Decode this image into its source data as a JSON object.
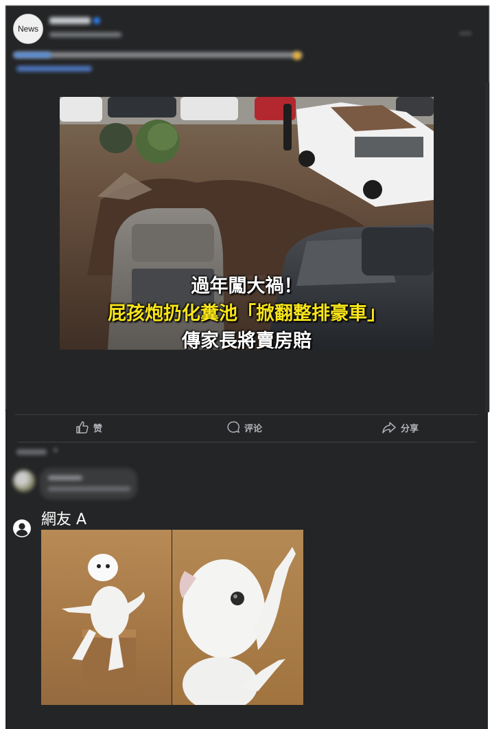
{
  "post": {
    "avatar_text": "News",
    "image_caption": {
      "line1": "過年闖大禍！",
      "line2": "屁孩炮扔化糞池「掀翻整排豪車」",
      "line3": "傳家長將賣房賠"
    }
  },
  "actions": {
    "like": "赞",
    "comment": "评论",
    "share": "分享"
  },
  "comment": {
    "author": "網友 A"
  },
  "colors": {
    "card_background": "#242526",
    "caption_yellow": "#f7e41a",
    "verified_blue": "#2d88ff"
  }
}
